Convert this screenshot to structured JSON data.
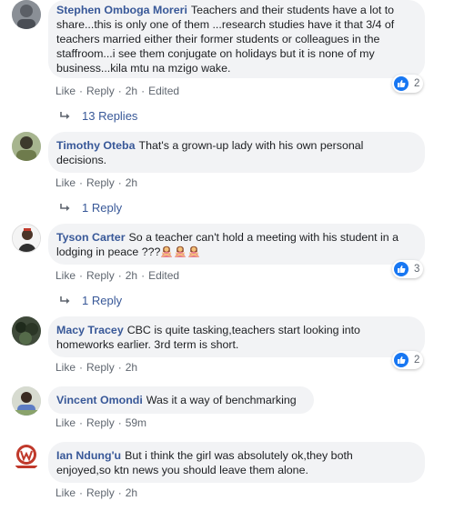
{
  "colors": {
    "link": "#385898",
    "bubble": "#f2f3f5",
    "meta": "#606770",
    "like_blue": "#1877f2"
  },
  "comments": [
    {
      "author": "Stephen Omboga Moreri",
      "lines": [
        "Teachers and their students have a lot to",
        "share...this is only one of them ...research studies have it that 3/4 of",
        "teachers married either their former students or colleagues in the",
        "staffroom...i see them conjugate on holidays but it is none of my",
        "business...kila mtu na mzigo wake."
      ],
      "actions": {
        "like": "Like",
        "reply": "Reply",
        "time": "2h",
        "edited": "Edited"
      },
      "reaction_count": "2",
      "replies": "13 Replies"
    },
    {
      "author": "Timothy Oteba",
      "lines": [
        "That's a grown-up lady with his own personal",
        "decisions."
      ],
      "actions": {
        "like": "Like",
        "reply": "Reply",
        "time": "2h"
      },
      "replies": "1 Reply"
    },
    {
      "author": "Tyson Carter",
      "lines": [
        "So a teacher can't hold a meeting with his student in a",
        "lodging in peace ???"
      ],
      "emoji": "person-gesturing-no-emoji",
      "actions": {
        "like": "Like",
        "reply": "Reply",
        "time": "2h",
        "edited": "Edited"
      },
      "reaction_count": "3",
      "replies": "1 Reply"
    },
    {
      "author": "Macy Tracey",
      "lines": [
        "CBC is quite tasking,teachers start looking into",
        "homeworks earlier. 3rd term is short."
      ],
      "actions": {
        "like": "Like",
        "reply": "Reply",
        "time": "2h"
      },
      "reaction_count": "2"
    },
    {
      "author": "Vincent Omondi",
      "lines": [
        "Was it a way of benchmarking"
      ],
      "actions": {
        "like": "Like",
        "reply": "Reply",
        "time": "59m"
      }
    },
    {
      "author": "Ian Ndung'u",
      "lines": [
        "But i think the girl was absolutely ok,they both",
        "enjoyed,so ktn news you should leave them alone."
      ],
      "actions": {
        "like": "Like",
        "reply": "Reply",
        "time": "2h"
      }
    }
  ]
}
